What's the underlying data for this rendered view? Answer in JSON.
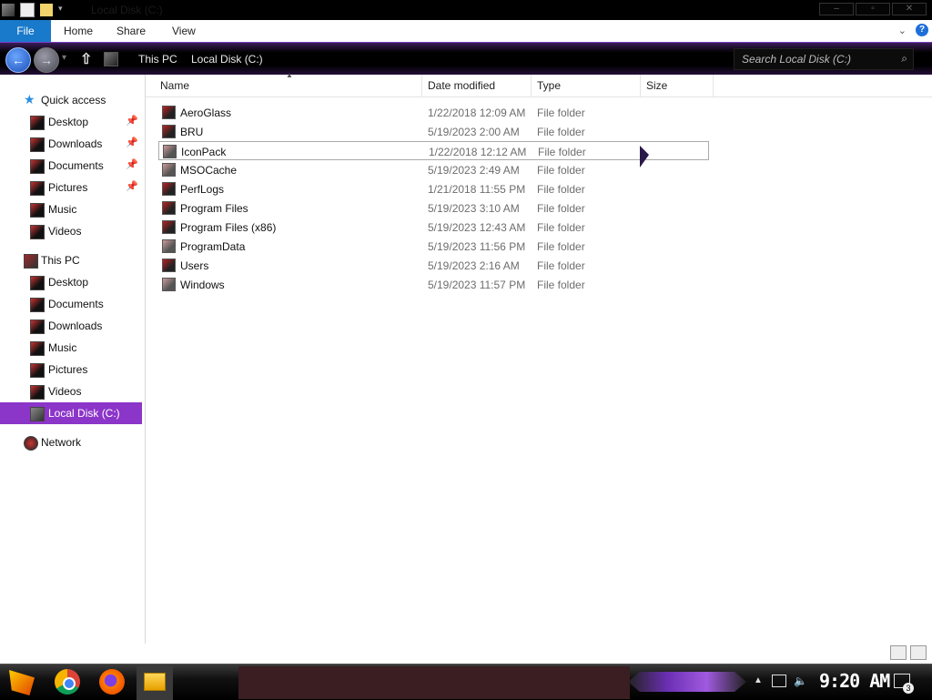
{
  "titlebar": {
    "title": "Local Disk (C:)",
    "minimize_label": "–",
    "maximize_label": "▫",
    "close_label": "✕"
  },
  "ribbon": {
    "tabs": [
      "File",
      "Home",
      "Share",
      "View"
    ],
    "help_label": "?"
  },
  "navigation": {
    "breadcrumbs": [
      "This PC",
      "Local Disk (C:)"
    ],
    "search_placeholder": "Search Local Disk (C:)"
  },
  "sidebar": {
    "quick_access": {
      "label": "Quick access",
      "items": [
        {
          "label": "Desktop",
          "pinned": true
        },
        {
          "label": "Downloads",
          "pinned": true
        },
        {
          "label": "Documents",
          "pinned": true
        },
        {
          "label": "Pictures",
          "pinned": true
        },
        {
          "label": "Music",
          "pinned": false
        },
        {
          "label": "Videos",
          "pinned": false
        }
      ]
    },
    "this_pc": {
      "label": "This PC",
      "items": [
        "Desktop",
        "Documents",
        "Downloads",
        "Music",
        "Pictures",
        "Videos",
        "Local Disk (C:)"
      ],
      "selected": "Local Disk (C:)"
    },
    "network": {
      "label": "Network"
    }
  },
  "columns": [
    "Name",
    "Date modified",
    "Type",
    "Size"
  ],
  "files": [
    {
      "name": "AeroGlass",
      "date": "1/22/2018 12:09 AM",
      "type": "File folder"
    },
    {
      "name": "BRU",
      "date": "5/19/2023 2:00 AM",
      "type": "File folder"
    },
    {
      "name": "IconPack",
      "date": "1/22/2018 12:12 AM",
      "type": "File folder"
    },
    {
      "name": "MSOCache",
      "date": "5/19/2023 2:49 AM",
      "type": "File folder"
    },
    {
      "name": "PerfLogs",
      "date": "1/21/2018 11:55 PM",
      "type": "File folder"
    },
    {
      "name": "Program Files",
      "date": "5/19/2023 3:10 AM",
      "type": "File folder"
    },
    {
      "name": "Program Files (x86)",
      "date": "5/19/2023 12:43 AM",
      "type": "File folder"
    },
    {
      "name": "ProgramData",
      "date": "5/19/2023 11:56 PM",
      "type": "File folder"
    },
    {
      "name": "Users",
      "date": "5/19/2023 2:16 AM",
      "type": "File folder"
    },
    {
      "name": "Windows",
      "date": "5/19/2023 11:57 PM",
      "type": "File folder"
    }
  ],
  "taskbar": {
    "clock": "9:20 AM",
    "notification_count": "3"
  }
}
